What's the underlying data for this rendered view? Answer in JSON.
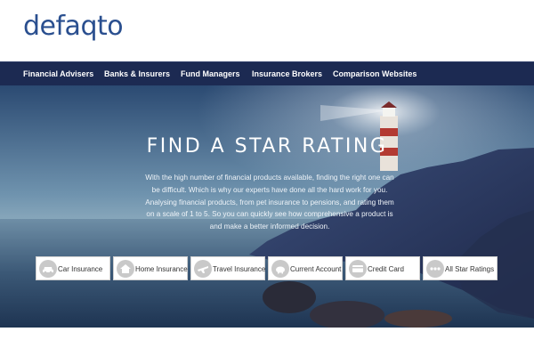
{
  "brand": {
    "logo_text": "defaqto"
  },
  "nav": {
    "items": [
      {
        "label": "Financial Advisers"
      },
      {
        "label": "Banks & Insurers"
      },
      {
        "label": "Fund Managers"
      },
      {
        "label": "Insurance Brokers"
      },
      {
        "label": "Comparison Websites"
      }
    ]
  },
  "hero": {
    "title": "FIND A STAR RATING",
    "description": "With the high number of financial products available, finding the right one can be difficult. Which is why our experts have done all the hard work for you. Analysing financial products, from pet insurance to pensions, and rating them on a scale of 1 to 5. So you can quickly see how comprehensive a product is and make a better informed decision."
  },
  "categories": [
    {
      "label": "Car Insurance",
      "icon": "car-icon"
    },
    {
      "label": "Home Insurance",
      "icon": "home-icon"
    },
    {
      "label": "Travel Insurance",
      "icon": "plane-icon"
    },
    {
      "label": "Current Account",
      "icon": "piggy-bank-icon"
    },
    {
      "label": "Credit Card",
      "icon": "credit-card-icon"
    },
    {
      "label": "All Star Ratings",
      "icon": "dots-icon"
    }
  ],
  "colors": {
    "brand_blue": "#2a4f8f",
    "nav_background": "#1c2a52",
    "icon_circle": "#c9c9c9"
  }
}
